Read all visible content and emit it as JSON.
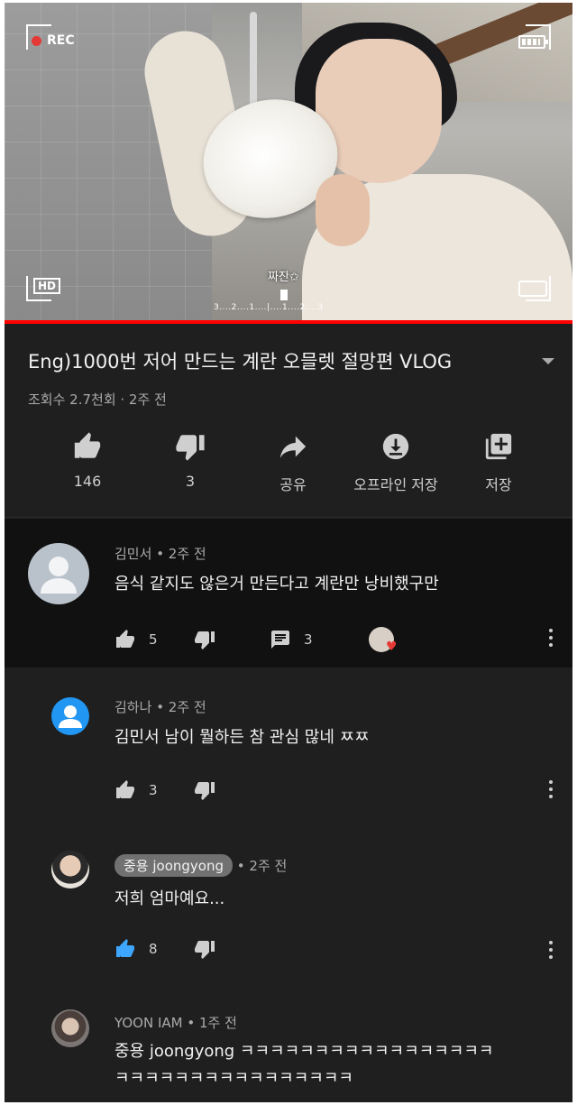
{
  "video": {
    "rec_label": "REC",
    "hd_label": "HD",
    "caption": "짜잔✩",
    "scale_text": "3....2....1....|....1....2....3"
  },
  "title": "Eng)1000번 저어 만드는 계란 오믈렛 절망편 VLOG",
  "meta": "조회수 2.7천회 · 2주 전",
  "actions": [
    {
      "icon": "thumb-up-icon",
      "label": "146"
    },
    {
      "icon": "thumb-down-icon",
      "label": "3"
    },
    {
      "icon": "share-icon",
      "label": "공유"
    },
    {
      "icon": "download-icon",
      "label": "오프라인 저장"
    },
    {
      "icon": "add-to-playlist-icon",
      "label": "저장"
    }
  ],
  "comments": [
    {
      "author": "김민서",
      "time": "• 2주 전",
      "text": "음식 같지도 않은거 만든다고 계란만 낭비했구만",
      "likes": "5",
      "replies": "3",
      "creator_hearted": true
    },
    {
      "author": "김하나",
      "time": "• 2주 전",
      "text": "김민서 남이 뭘하든 참 관심 많네 ㅉㅉ",
      "likes": "3"
    },
    {
      "author": "중용 joongyong",
      "time": "• 2주 전",
      "text": "저희 엄마예요...",
      "likes": "8",
      "liked": true
    },
    {
      "author": "YOON IAM",
      "time": "• 1주 전",
      "text_line1": "중용 joongyong ㅋㅋㅋㅋㅋㅋㅋㅋㅋㅋㅋㅋㅋㅋㅋㅋㅋ",
      "text_line2": "ㅋㅋㅋㅋㅋㅋㅋㅋㅋㅋㅋㅋㅋㅋㅋㅋ"
    }
  ],
  "colors": {
    "background": "#1f1f1f",
    "highlighted_comment": "#111111",
    "progress": "#ff0000",
    "liked_blue": "#3ea6ff"
  }
}
